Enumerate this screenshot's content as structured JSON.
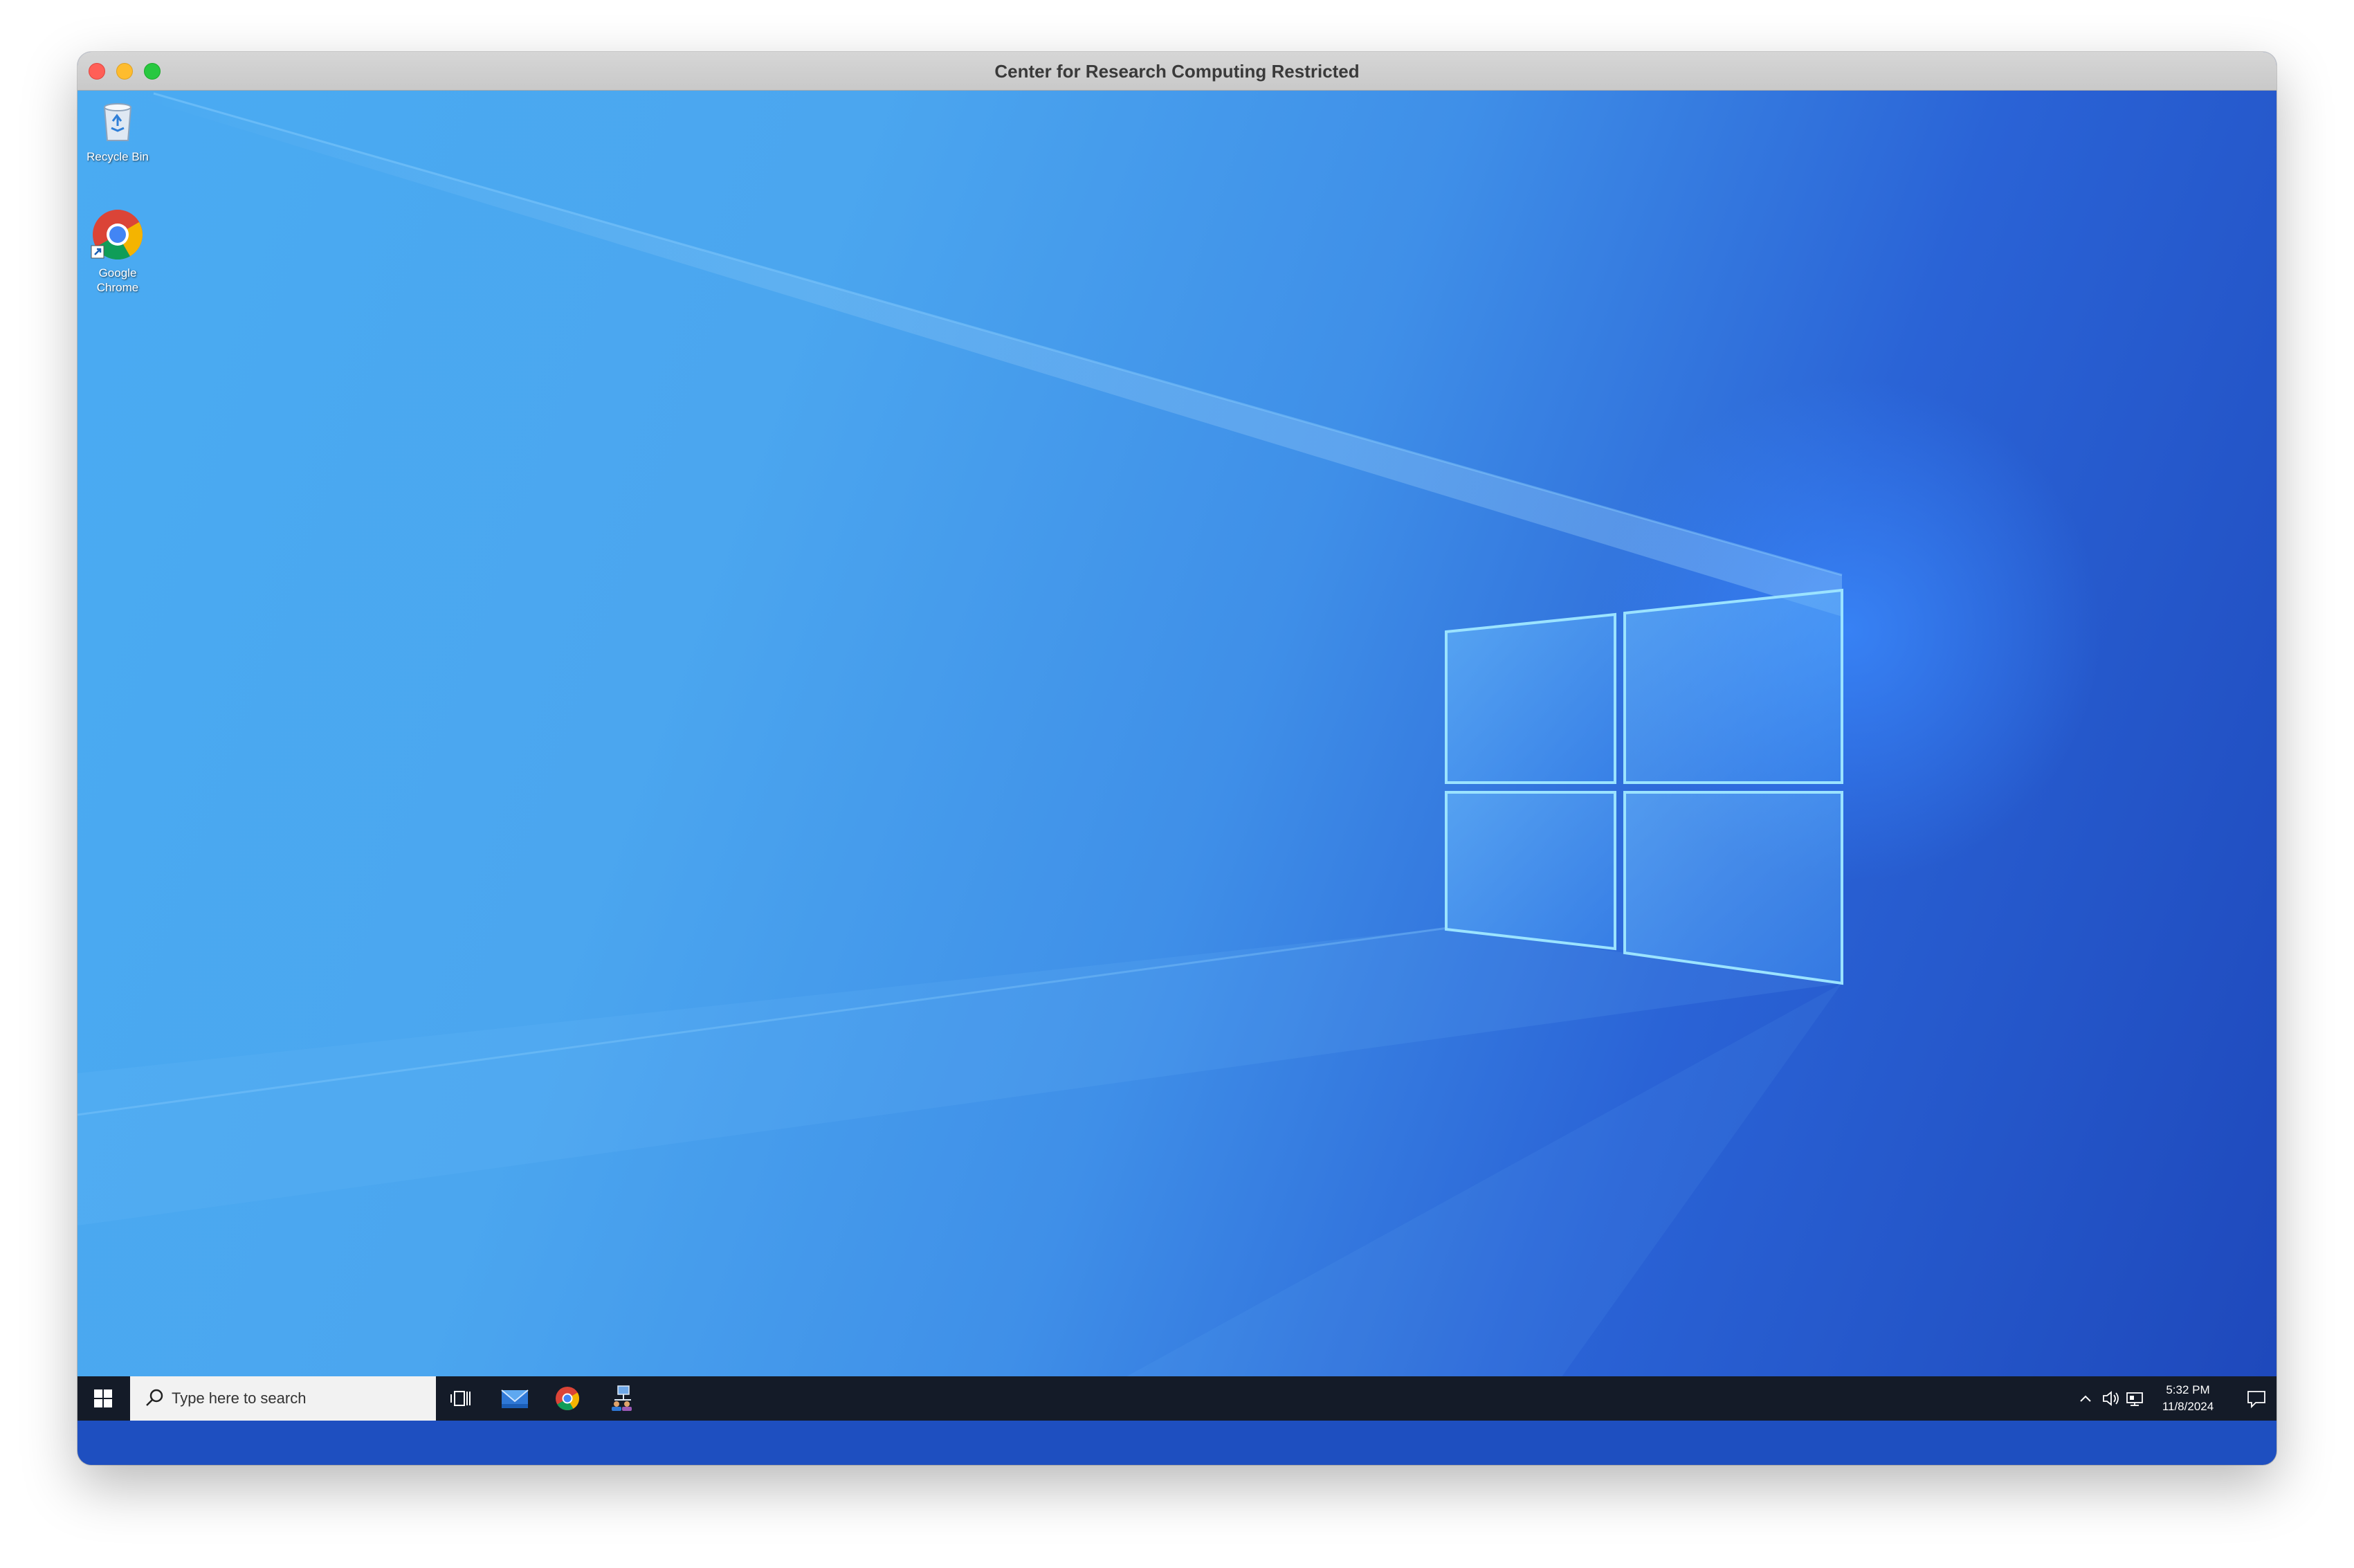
{
  "window": {
    "title": "Center for Research Computing Restricted"
  },
  "desktop": {
    "icons": [
      {
        "label": "Recycle Bin",
        "icon": "recycle-bin-icon"
      },
      {
        "label": "Google Chrome",
        "icon": "chrome-icon"
      }
    ]
  },
  "taskbar": {
    "start_icon": "windows-start-icon",
    "search_placeholder": "Type here to search",
    "pinned": [
      {
        "icon": "task-view-icon"
      },
      {
        "icon": "mail-icon"
      },
      {
        "icon": "chrome-icon"
      },
      {
        "icon": "network-users-icon"
      }
    ],
    "tray": {
      "icons": [
        "chevron-up-icon",
        "speaker-icon",
        "network-icon"
      ],
      "time": "5:32 PM",
      "date": "11/8/2024",
      "notification_icon": "notification-icon"
    }
  },
  "colors": {
    "wallpaper_light": "#4aabf2",
    "wallpaper_dark": "#1e48bb",
    "taskbar": "#141b28"
  }
}
